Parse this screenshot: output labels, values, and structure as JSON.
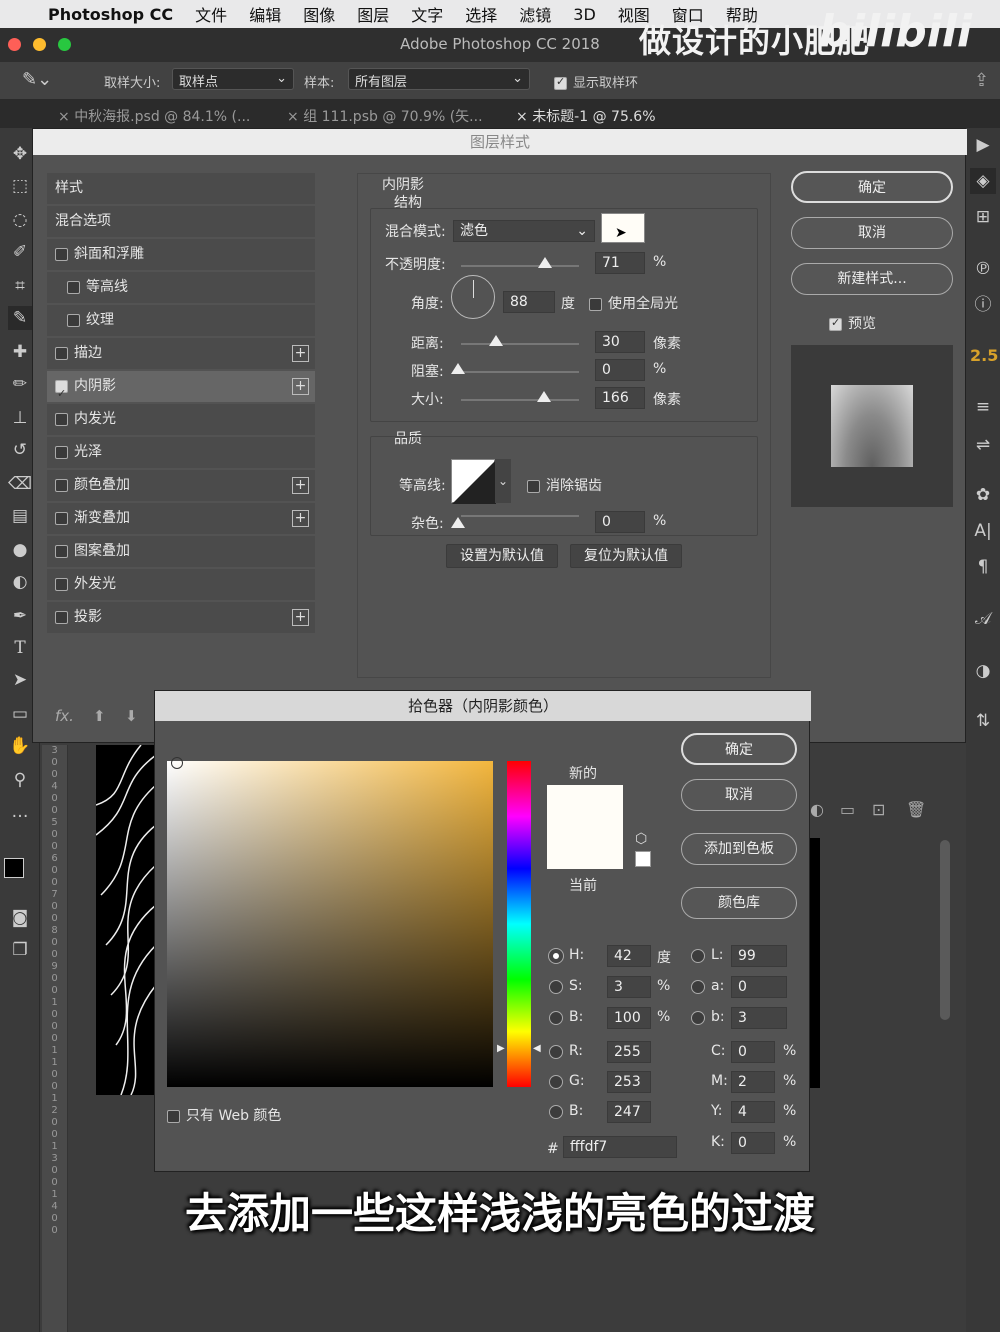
{
  "menubar": {
    "apple": "",
    "app": "Photoshop CC",
    "items": [
      "文件",
      "编辑",
      "图像",
      "图层",
      "文字",
      "选择",
      "滤镜",
      "3D",
      "视图",
      "窗口",
      "帮助"
    ]
  },
  "titlebar": {
    "title": "Adobe Photoshop CC 2018"
  },
  "watermark": {
    "text": "做设计的小肥肥",
    "logo": "bilibili"
  },
  "options": {
    "sample_size_label": "取样大小:",
    "sample_size_value": "取样点",
    "sample_label": "样本:",
    "sample_value": "所有图层",
    "show_ring_label": "显示取样环"
  },
  "tabs": [
    {
      "label": "中秋海报.psd @ 84.1% (..."
    },
    {
      "label": "组 111.psb @ 70.9% (矢..."
    },
    {
      "label": "未标题-1 @ 75.6%"
    }
  ],
  "layer_style": {
    "title": "图层样式",
    "list_header": "样式",
    "items": [
      {
        "label": "混合选项",
        "checkbox": false,
        "plus": false,
        "indent": false
      },
      {
        "label": "斜面和浮雕",
        "checkbox": true,
        "checked": false,
        "plus": false,
        "indent": false
      },
      {
        "label": "等高线",
        "checkbox": true,
        "checked": false,
        "plus": false,
        "indent": true
      },
      {
        "label": "纹理",
        "checkbox": true,
        "checked": false,
        "plus": false,
        "indent": true
      },
      {
        "label": "描边",
        "checkbox": true,
        "checked": false,
        "plus": true,
        "indent": false
      },
      {
        "label": "内阴影",
        "checkbox": true,
        "checked": true,
        "plus": true,
        "indent": false,
        "active": true
      },
      {
        "label": "内发光",
        "checkbox": true,
        "checked": false,
        "plus": false,
        "indent": false
      },
      {
        "label": "光泽",
        "checkbox": true,
        "checked": false,
        "plus": false,
        "indent": false
      },
      {
        "label": "颜色叠加",
        "checkbox": true,
        "checked": false,
        "plus": true,
        "indent": false
      },
      {
        "label": "渐变叠加",
        "checkbox": true,
        "checked": false,
        "plus": true,
        "indent": false
      },
      {
        "label": "图案叠加",
        "checkbox": true,
        "checked": false,
        "plus": false,
        "indent": false
      },
      {
        "label": "外发光",
        "checkbox": true,
        "checked": false,
        "plus": false,
        "indent": false
      },
      {
        "label": "投影",
        "checkbox": true,
        "checked": false,
        "plus": true,
        "indent": false
      }
    ],
    "fx_label": "fx.",
    "section_title": "内阴影",
    "structure_title": "结构",
    "blend_mode_label": "混合模式:",
    "blend_mode_value": "滤色",
    "blend_color": "#fffdf7",
    "opacity_label": "不透明度:",
    "opacity_value": "71",
    "opacity_unit": "%",
    "angle_label": "角度:",
    "angle_value": "88",
    "angle_unit": "度",
    "global_light_label": "使用全局光",
    "distance_label": "距离:",
    "distance_value": "30",
    "distance_unit": "像素",
    "choke_label": "阻塞:",
    "choke_value": "0",
    "choke_unit": "%",
    "size_label": "大小:",
    "size_value": "166",
    "size_unit": "像素",
    "quality_title": "品质",
    "contour_label": "等高线:",
    "antialias_label": "消除锯齿",
    "noise_label": "杂色:",
    "noise_value": "0",
    "noise_unit": "%",
    "set_default": "设置为默认值",
    "reset_default": "复位为默认值",
    "ok": "确定",
    "cancel": "取消",
    "new_style": "新建样式...",
    "preview_label": "预览"
  },
  "color_picker": {
    "title": "拾色器（内阴影颜色）",
    "ok": "确定",
    "cancel": "取消",
    "add_swatch": "添加到色板",
    "color_lib": "颜色库",
    "new_label": "新的",
    "current_label": "当前",
    "new_color": "#fffdf7",
    "current_color": "#fffdf7",
    "web_only": "只有 Web 颜色",
    "hsb": [
      {
        "label": "H:",
        "value": "42",
        "unit": "度",
        "on": true
      },
      {
        "label": "S:",
        "value": "3",
        "unit": "%",
        "on": false
      },
      {
        "label": "B:",
        "value": "100",
        "unit": "%",
        "on": false
      }
    ],
    "lab": [
      {
        "label": "L:",
        "value": "99"
      },
      {
        "label": "a:",
        "value": "0"
      },
      {
        "label": "b:",
        "value": "3"
      }
    ],
    "rgb": [
      {
        "label": "R:",
        "value": "255"
      },
      {
        "label": "G:",
        "value": "253"
      },
      {
        "label": "B:",
        "value": "247"
      }
    ],
    "cmyk": [
      {
        "label": "C:",
        "value": "0",
        "unit": "%"
      },
      {
        "label": "M:",
        "value": "2",
        "unit": "%"
      },
      {
        "label": "Y:",
        "value": "4",
        "unit": "%"
      },
      {
        "label": "K:",
        "value": "0",
        "unit": "%"
      }
    ],
    "hex_label": "#",
    "hex_value": "fffdf7"
  },
  "right_panel": {
    "value": "2.5"
  },
  "subtitle": "去添加一些这样浅浅的亮色的过渡"
}
